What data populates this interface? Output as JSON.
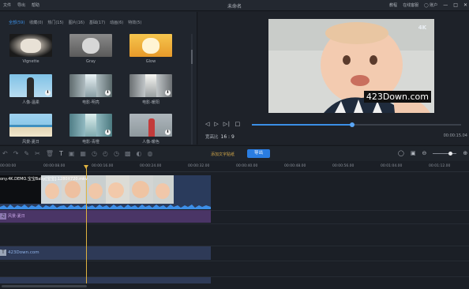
{
  "titlebar": {
    "menu": [
      "文件",
      "导出",
      "帮助"
    ],
    "title": "未命名",
    "tutorial": "教程",
    "online_server": "在线客服",
    "account": "账户",
    "controls": [
      "—",
      "□",
      "✕"
    ]
  },
  "library": {
    "tabs": [
      "全部(59)",
      "收藏(0)",
      "热门(15)",
      "图片(16)",
      "基础(17)",
      "动画(6)",
      "特效(5)"
    ],
    "items": [
      {
        "label": "Vignette",
        "download": false
      },
      {
        "label": "Gray",
        "download": false
      },
      {
        "label": "Glow",
        "download": false
      },
      {
        "label": "人像-温柔",
        "download": true
      },
      {
        "label": "电影-明亮",
        "download": true
      },
      {
        "label": "电影-暖阳",
        "download": true
      },
      {
        "label": "风景-夏日",
        "download": false
      },
      {
        "label": "电影-青橙",
        "download": true
      },
      {
        "label": "人像-暖色",
        "download": true
      }
    ]
  },
  "preview": {
    "watermark_4k": "4K",
    "watermark_text": "423Down.com",
    "aspect_label": "宽高比",
    "aspect_value": "16 : 9",
    "timecode": "00:00:15.04",
    "progress": 0.48
  },
  "toolbar": {
    "hint": "添加文字贴纸",
    "export_label": "导出"
  },
  "ruler": [
    "00:00:00",
    "00:00:08.00",
    "00:00:16.00",
    "00:00:24.00",
    "00:00:32.00",
    "00:00:40.00",
    "00:00:48.00",
    "00:00:56.00",
    "00:01:04.00",
    "00:01:12.00"
  ],
  "timeline": {
    "video_clip_name": "ony.4K.DEMO.宝宝Baby[宝宝].1280X720.mkv",
    "music_clip_name": "风景-夏日",
    "text_clip_name": "423Down.com",
    "text_icon": "T"
  },
  "colors": {
    "accent": "#2a7de1",
    "playhead": "#e0b340",
    "music_clip": "#4a3566",
    "text_clip": "#2e3a57"
  }
}
